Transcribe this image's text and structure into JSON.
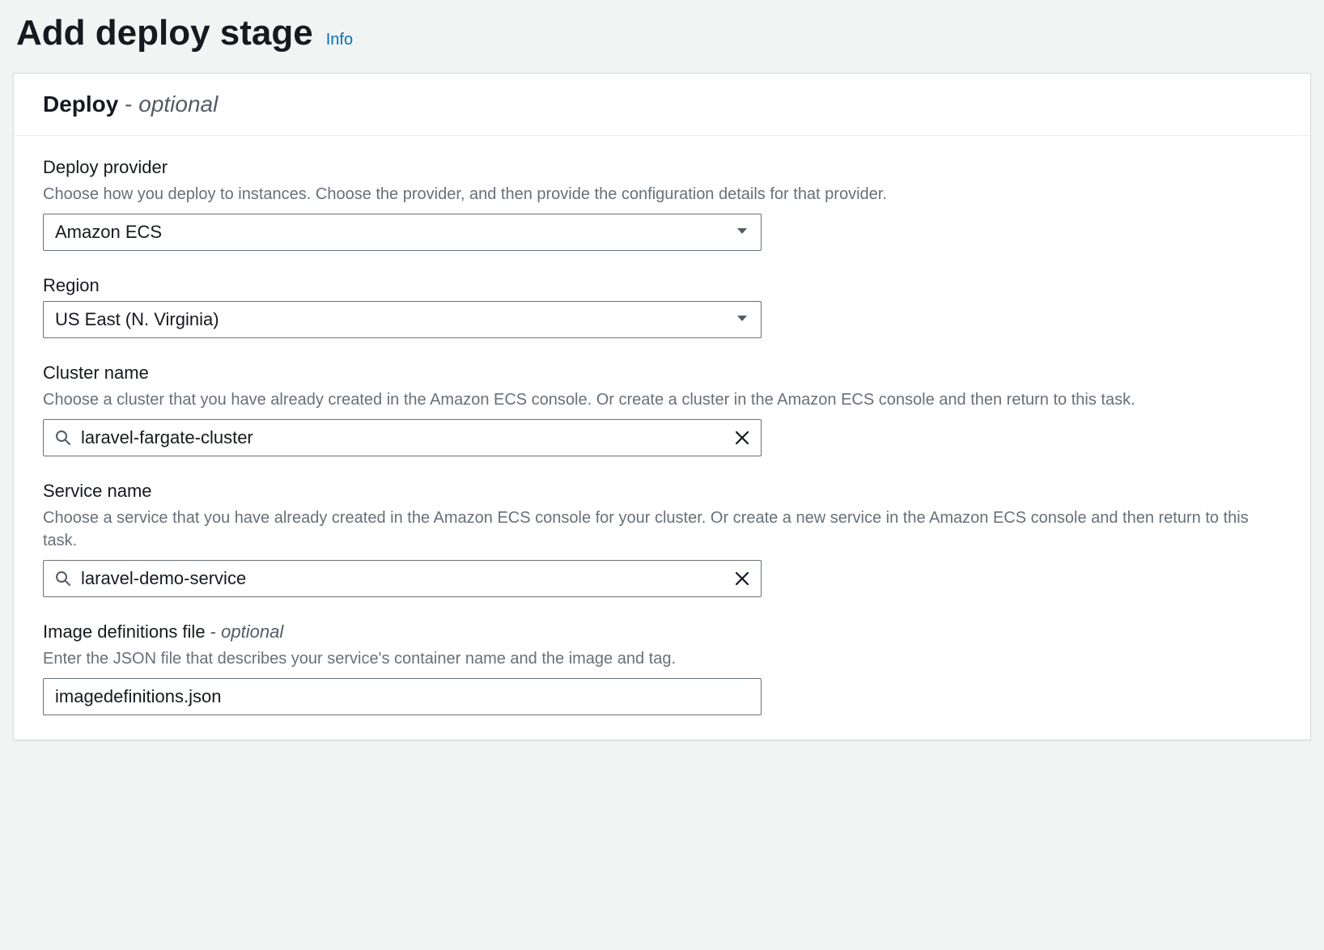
{
  "page": {
    "title": "Add deploy stage",
    "info_link": "Info"
  },
  "card": {
    "title": "Deploy",
    "optional": "optional"
  },
  "deploy_provider": {
    "label": "Deploy provider",
    "help": "Choose how you deploy to instances. Choose the provider, and then provide the configuration details for that provider.",
    "value": "Amazon ECS"
  },
  "region": {
    "label": "Region",
    "value": "US East (N. Virginia)"
  },
  "cluster_name": {
    "label": "Cluster name",
    "help": "Choose a cluster that you have already created in the Amazon ECS console. Or create a cluster in the Amazon ECS console and then return to this task.",
    "value": "laravel-fargate-cluster"
  },
  "service_name": {
    "label": "Service name",
    "help": "Choose a service that you have already created in the Amazon ECS console for your cluster. Or create a new service in the Amazon ECS console and then return to this task.",
    "value": "laravel-demo-service"
  },
  "image_definitions": {
    "label": "Image definitions file",
    "optional": "optional",
    "help": "Enter the JSON file that describes your service's container name and the image and tag.",
    "value": "imagedefinitions.json"
  }
}
